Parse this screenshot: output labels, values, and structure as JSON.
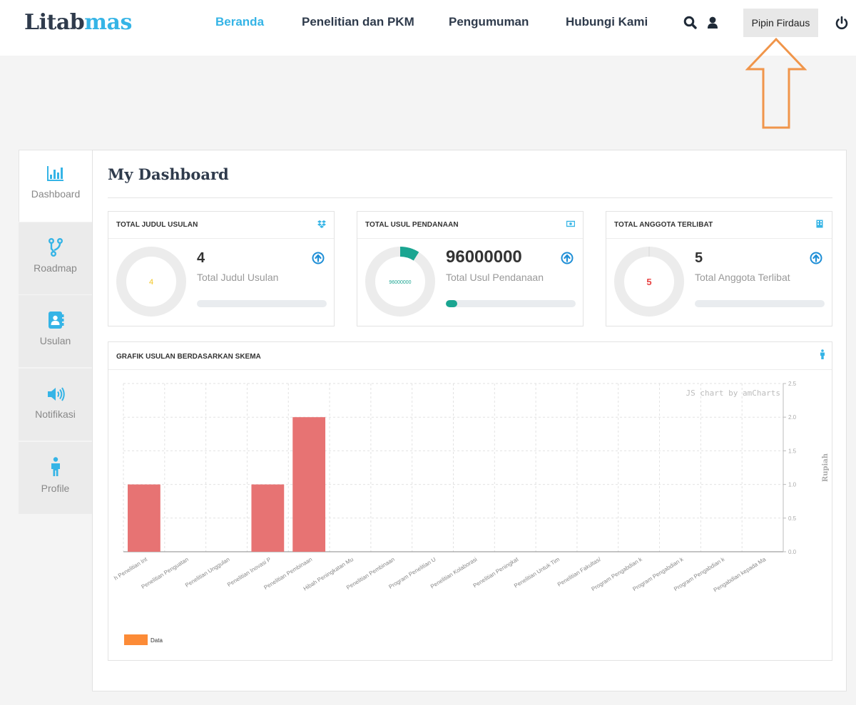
{
  "header": {
    "logo_dark": "Litab",
    "logo_accent": "mas",
    "nav": [
      {
        "label": "Beranda",
        "active": true
      },
      {
        "label": "Penelitian dan PKM",
        "active": false
      },
      {
        "label": "Pengumuman",
        "active": false
      },
      {
        "label": "Hubungi Kami",
        "active": false
      }
    ],
    "icons": [
      "search-icon",
      "user-icon",
      "power-icon"
    ],
    "user_name": "Pipin Firdaus"
  },
  "sidebar": {
    "items": [
      {
        "label": "Dashboard",
        "icon": "bar-chart-icon",
        "active": true
      },
      {
        "label": "Roadmap",
        "icon": "code-fork-icon",
        "active": false
      },
      {
        "label": "Usulan",
        "icon": "address-book-icon",
        "active": false
      },
      {
        "label": "Notifikasi",
        "icon": "volume-up-icon",
        "active": false
      },
      {
        "label": "Profile",
        "icon": "male-figure-icon",
        "active": false
      }
    ]
  },
  "dashboard": {
    "title": "My Dashboard",
    "cards": [
      {
        "title": "TOTAL JUDUL USULAN",
        "icon": "dropbox-icon",
        "value": "4",
        "ring_value": "4",
        "ring_color": "#f3c624",
        "ring_fraction": 0.0,
        "label": "Total Judul Usulan",
        "progress": 0.0
      },
      {
        "title": "TOTAL USUL PENDANAAN",
        "icon": "money-icon",
        "value": "96000000",
        "ring_value": "96000000",
        "ring_color": "#1aa591",
        "ring_fraction": 0.09,
        "label": "Total Usul Pendanaan",
        "progress": 0.09
      },
      {
        "title": "TOTAL ANGGOTA TERLIBAT",
        "icon": "building-icon",
        "value": "5",
        "ring_value": "5",
        "ring_color": "#e84343",
        "ring_fraction": 0.0,
        "label": "Total Anggota Terlibat",
        "progress": 0.0
      }
    ]
  },
  "chart_section": {
    "title": "GRAFIK USULAN BERDASARKAN SKEMA",
    "icon": "person-icon",
    "credit": "JS chart by amCharts"
  },
  "chart_data": {
    "type": "bar",
    "categories": [
      "h Penelitian Int",
      "Penelitian Penguatan",
      "Penelitian Unggulan",
      "Penelitian Inovasi P",
      "Penelitian Pembinaan",
      "Hibah Peningkatan Mu",
      "Penelitian Pembinaan",
      "Program Penelitian U",
      "Penelitian Kolaborasi",
      "Penelitian Peningkat",
      "Penelitian Untuk Tim",
      "Penelitian Fakultas/",
      "Program Pengabdian k",
      "Program Pengabdian k",
      "Program Pengabdian k",
      "Pengabdian kepada Ma"
    ],
    "series": [
      {
        "name": "Data",
        "values": [
          1,
          0,
          0,
          1,
          2,
          0,
          0,
          0,
          0,
          0,
          0,
          0,
          0,
          0,
          0,
          0
        ]
      }
    ],
    "bar_color": "#e77373",
    "legend_color": "#fc8b37",
    "ylabel": "Rupiah",
    "ylim": [
      0,
      2.5
    ],
    "yticks": [
      "0.0",
      "0.5",
      "1.0",
      "1.5",
      "2.0",
      "2.5"
    ],
    "y_axis_side": "right",
    "grid": true,
    "legend_position": "bottom-left"
  }
}
